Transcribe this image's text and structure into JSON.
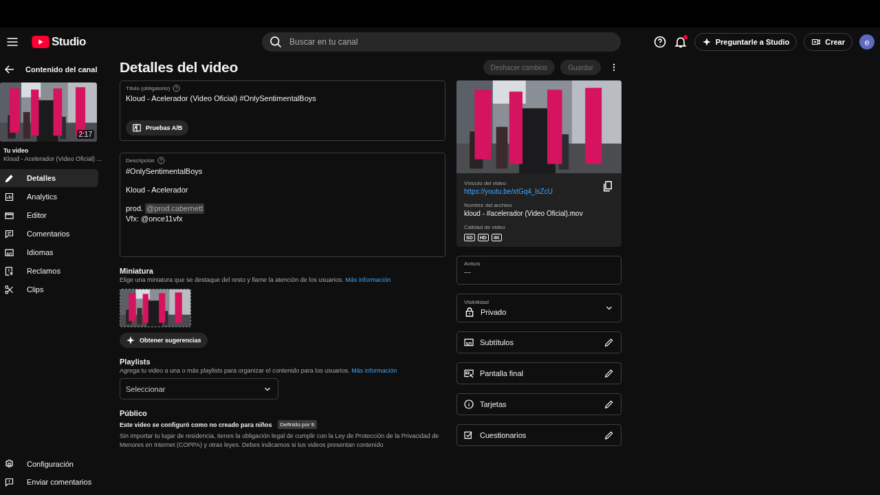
{
  "header": {
    "logo_text": "Studio",
    "search": {
      "placeholder": "Buscar en tu canal"
    },
    "notification_dot": true,
    "ask_button": "Preguntarle a Studio",
    "create_button": "Crear",
    "avatar_letter": "e"
  },
  "sidebar": {
    "back_label": "Contenido del canal",
    "thumbnail": {
      "kind": "picture",
      "duration": "2:17"
    },
    "your_video_label": "Tu video",
    "video_title": "Kloud - Acelerador (Video Oficial) ...",
    "items": [
      {
        "kind": "details",
        "label": "Detalles",
        "selected": true
      },
      {
        "kind": "analytics",
        "label": "Analytics",
        "selected": false
      },
      {
        "kind": "editor",
        "label": "Editor",
        "selected": false
      },
      {
        "kind": "comments",
        "label": "Comentarios",
        "selected": false
      },
      {
        "kind": "languages",
        "label": "Idiomas",
        "selected": false
      },
      {
        "kind": "claims",
        "label": "Reclamos",
        "selected": false
      },
      {
        "kind": "clips",
        "label": "Clips",
        "selected": false
      }
    ],
    "footer_items": [
      {
        "kind": "settings",
        "label": "Configuración"
      },
      {
        "kind": "feedback",
        "label": "Enviar comentarios"
      }
    ]
  },
  "main": {
    "heading": "Detalles del video",
    "actions": [
      {
        "label": "Deshacer cambios",
        "disabled": true
      },
      {
        "label": "Guardar",
        "disabled": true
      }
    ],
    "title_field": {
      "label": "Título (obligatorio)",
      "value": "Kloud - Acelerador (Video Oficial) #OnlySentimentalBoys",
      "ab_button": "Pruebas A/B"
    },
    "description_field": {
      "label": "Descripción",
      "paragraphs": [
        [
          {
            "text": "#OnlySentimentalBoys"
          }
        ],
        [
          {
            "text": "Kloud - Acelerador"
          }
        ],
        [
          {
            "text": "prod.",
            "mention": "@prod.cabernett"
          },
          {
            "text": "Vfx: @once11vfx"
          }
        ]
      ]
    },
    "thumbnail_section": {
      "heading": "Miniatura",
      "description": "Elige una miniatura que se destaque del resto y llame la atención de los usuarios.",
      "link": "Más información",
      "thumbnail": {
        "kind": "picture"
      },
      "suggest_button": "Obtener sugerencias"
    },
    "playlists": {
      "heading": "Playlists",
      "description": "Agrega tu video a una o más playlists para organizar el contenido para los usuarios.",
      "link": "Más información",
      "select_placeholder": "Seleccionar"
    },
    "audience": {
      "heading": "Público",
      "status": "Este video se configuró como no creado para niños",
      "badge": "Definido por ti",
      "paragraph": "Sin importar tu lugar de residencia, tienes la obligación legal de cumplir con la Ley de Protección de la Privacidad de Menores en Internet (COPPA) y otras leyes. Debes indicarnos si tus videos presentan contenido"
    }
  },
  "video_card": {
    "preview": {
      "kind": "picture"
    },
    "link_label": "Vínculo del video",
    "link": "https://youtu.be/xtGq4_lsZcU",
    "filename_label": "Nombre del archivo",
    "filename": "kloud - #acelerador (Video Oficial).mov",
    "quality_label": "Calidad de video",
    "qualities": [
      "SD",
      "HD",
      "4K"
    ]
  },
  "notices": {
    "label": "Avisos",
    "value": "—"
  },
  "visibility": {
    "label": "Visibilidad",
    "value": "Privado"
  },
  "options": [
    {
      "kind": "subtitles",
      "label": "Subtítulos"
    },
    {
      "kind": "endscreen",
      "label": "Pantalla final"
    },
    {
      "kind": "cards",
      "label": "Tarjetas"
    },
    {
      "kind": "quizzes",
      "label": "Cuestionarios"
    }
  ]
}
